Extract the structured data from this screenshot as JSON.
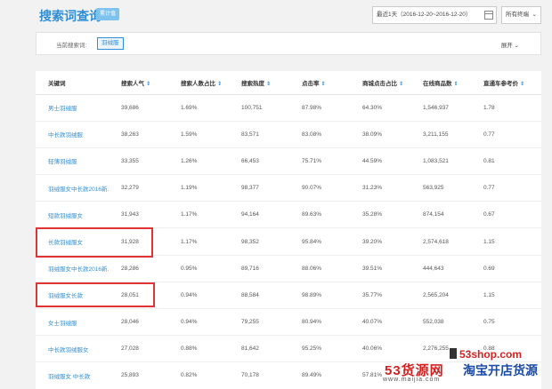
{
  "header": {
    "title": "搜索词查询",
    "badge": "累计值",
    "date_range": "最近1天（2016-12-20~2016-12-20）",
    "terminal": "所有终端"
  },
  "filter": {
    "label": "当前搜索词:",
    "tag": "羽绒服",
    "expand": "展开"
  },
  "table": {
    "columns": [
      "关键词",
      "搜索人气",
      "搜索人数占比",
      "搜索热度",
      "点击率",
      "商城点击占比",
      "在线商品数",
      "直通车参考价"
    ],
    "rows": [
      [
        "男士羽绒服",
        "39,686",
        "1.69%",
        "100,751",
        "87.98%",
        "64.30%",
        "1,546,937",
        "1.78"
      ],
      [
        "中长款羽绒服",
        "38,263",
        "1.59%",
        "83,571",
        "83.08%",
        "38.09%",
        "3,211,155",
        "0.77"
      ],
      [
        "轻薄羽绒服",
        "33,355",
        "1.26%",
        "66,453",
        "75.71%",
        "44.59%",
        "1,083,521",
        "0.81"
      ],
      [
        "羽绒服女中长款2016新…",
        "32,279",
        "1.19%",
        "98,377",
        "90.07%",
        "31.23%",
        "563,925",
        "0.77"
      ],
      [
        "短款羽绒服女",
        "31,943",
        "1.17%",
        "94,164",
        "89.63%",
        "35.28%",
        "874,154",
        "0.67"
      ],
      [
        "长款羽绒服女",
        "31,928",
        "1.17%",
        "98,352",
        "95.84%",
        "39.20%",
        "2,574,618",
        "1.15"
      ],
      [
        "羽绒服女中长款2016新…",
        "28,286",
        "0.95%",
        "89,716",
        "88.06%",
        "39.51%",
        "444,643",
        "0.69"
      ],
      [
        "羽绒服女长款",
        "28,051",
        "0.94%",
        "88,584",
        "98.89%",
        "35.77%",
        "2,565,204",
        "1.15"
      ],
      [
        "女士羽绒服",
        "28,046",
        "0.94%",
        "79,255",
        "80.94%",
        "40.07%",
        "552,038",
        "0.75"
      ],
      [
        "中长款羽绒服女",
        "27,028",
        "0.88%",
        "81,642",
        "95.25%",
        "40.06%",
        "2,276,255",
        "0.88"
      ],
      [
        "羽绒服女 中长款",
        "25,893",
        "0.82%",
        "70,178",
        "89.49%",
        "57.81%",
        "",
        ""
      ]
    ]
  },
  "watermark": {
    "url": "53shop.com",
    "name_red": "53货源网",
    "name_blue": "淘宝开店货源",
    "domain": "www.maijia.com"
  }
}
